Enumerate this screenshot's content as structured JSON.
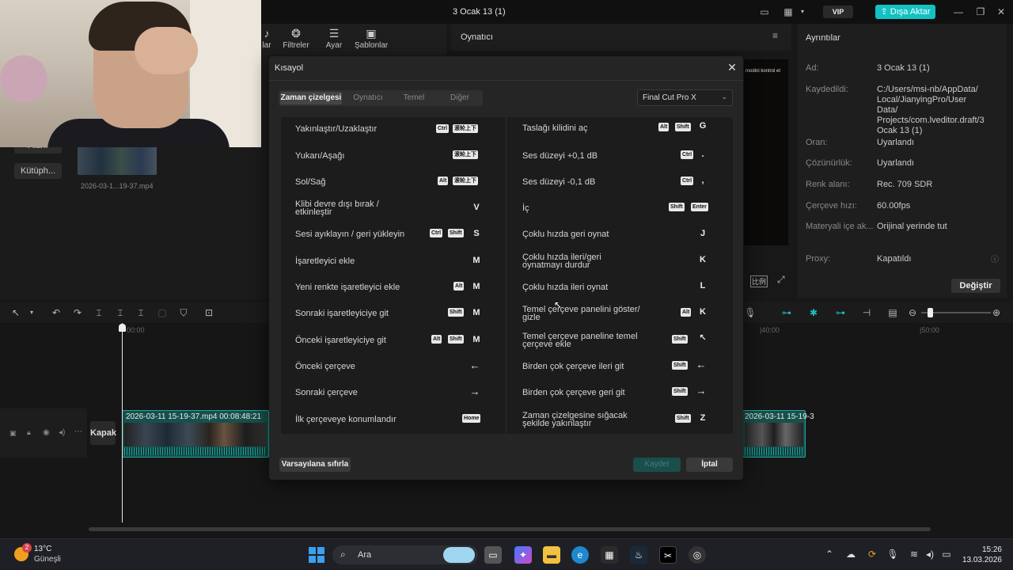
{
  "window": {
    "title": "3 Ocak 13 (1)"
  },
  "titlebar": {
    "vip_label": "VIP",
    "export_label": "Dışa Aktar",
    "export_icon": "share-icon",
    "minimize_icon": "minimize-icon",
    "maximize_icon": "restore-icon",
    "close_icon": "close-icon"
  },
  "toolbar": {
    "items": [
      {
        "label": "lar",
        "icon": "audio-icon"
      },
      {
        "label": "Filtreler",
        "icon": "filter-icon"
      },
      {
        "label": "Ayar",
        "icon": "sliders-icon"
      },
      {
        "label": "Şablonlar",
        "icon": "template-icon"
      }
    ]
  },
  "media": {
    "side_items": [
      {
        "label": "Alanı"
      },
      {
        "label": "Kütüph..."
      }
    ],
    "thumb_label": "2026-03-1...19-37.mp4"
  },
  "player": {
    "title": "Oynatıcı",
    "overlay_text": "modini kontrol et"
  },
  "details": {
    "title": "Ayrıntılar",
    "rows": [
      {
        "label": "Ad:",
        "value": "3 Ocak 13 (1)"
      },
      {
        "label": "Kaydedildi:",
        "value": "C:/Users/msi-nb/AppData/ Local/JianyingPro/User Data/ Projects/com.lveditor.draft/3 Ocak 13 (1)"
      },
      {
        "label": "Oran:",
        "value": "Uyarlandı"
      },
      {
        "label": "Çözünürlük:",
        "value": "Uyarlandı"
      },
      {
        "label": "Renk alanı:",
        "value": "Rec. 709 SDR"
      },
      {
        "label": "Çerçeve hızı:",
        "value": "60.00fps"
      },
      {
        "label": "Materyali içe ak...",
        "value": "Orijinal yerinde tut"
      },
      {
        "label": "Proxy:",
        "value": "Kapatıldı"
      }
    ],
    "change_label": "Değiştir"
  },
  "timeline": {
    "ruler": [
      "00:00",
      "|40:00",
      "|50:00"
    ],
    "cover_label": "Kapak",
    "clip1_label": "2026-03-11 15-19-37.mp4  00:08:48:21",
    "clip2_label": "2026-03-11 15-19-3"
  },
  "dialog": {
    "title": "Kısayol",
    "tabs": [
      "Zaman çizelgesi",
      "Oynatıcı",
      "Temel",
      "Diğer"
    ],
    "active_tab": "Zaman çizelgesi",
    "preset": "Final Cut Pro X",
    "left_rows": [
      {
        "label": "Yakınlaştır/Uzaklaştır",
        "mods": [
          "Ctrl",
          "滚轮上下"
        ],
        "key": ""
      },
      {
        "label": "Yukarı/Aşağı",
        "mods": [
          "滚轮上下"
        ],
        "key": ""
      },
      {
        "label": "Sol/Sağ",
        "mods": [
          "Alt",
          "滚轮上下"
        ],
        "key": ""
      },
      {
        "label": "Klibi devre dışı bırak / etkinleştir",
        "mods": [],
        "key": "V"
      },
      {
        "label": "Sesi ayıklayın / geri yükleyin",
        "mods": [
          "Ctrl",
          "Shift"
        ],
        "key": "S"
      },
      {
        "label": "İşaretleyici ekle",
        "mods": [],
        "key": "M"
      },
      {
        "label": "Yeni renkte işaretleyici ekle",
        "mods": [
          "Alt"
        ],
        "key": "M"
      },
      {
        "label": "Sonraki işaretleyiciye git",
        "mods": [
          "Shift"
        ],
        "key": "M"
      },
      {
        "label": "Önceki işaretleyiciye git",
        "mods": [
          "Alt",
          "Shift"
        ],
        "key": "M"
      },
      {
        "label": "Önceki çerçeve",
        "mods": [],
        "key": "←"
      },
      {
        "label": "Sonraki çerçeve",
        "mods": [],
        "key": "→"
      },
      {
        "label": "İlk çerçeveye konumlandır",
        "mods": [
          "Home"
        ],
        "key": ""
      }
    ],
    "right_rows": [
      {
        "label": "Taslağı kilidini aç",
        "mods": [
          "Alt",
          "Shift"
        ],
        "key": "G"
      },
      {
        "label": "Ses düzeyi +0,1 dB",
        "mods": [
          "Ctrl"
        ],
        "key": "."
      },
      {
        "label": "Ses düzeyi -0,1 dB",
        "mods": [
          "Ctrl"
        ],
        "key": ","
      },
      {
        "label": "İç",
        "mods": [
          "Shift",
          "Enter"
        ],
        "key": ""
      },
      {
        "label": "Çoklu hızda geri oynat",
        "mods": [],
        "key": "J"
      },
      {
        "label": "Çoklu hızda ileri/geri oynatmayı durdur",
        "mods": [],
        "key": "K"
      },
      {
        "label": "Çoklu hızda ileri oynat",
        "mods": [],
        "key": "L"
      },
      {
        "label": "Temel çerçeve panelini göster/ gizle",
        "mods": [
          "Alt"
        ],
        "key": "K"
      },
      {
        "label": "Temel çerçeve paneline temel çerçeve ekle",
        "mods": [
          "Shift"
        ],
        "key": ""
      },
      {
        "label": "Birden çok çerçeve ileri git",
        "mods": [
          "Shift"
        ],
        "key": "←"
      },
      {
        "label": "Birden çok çerçeve geri git",
        "mods": [
          "Shift"
        ],
        "key": "→"
      },
      {
        "label": "Zaman çizelgesine sığacak şekilde yakınlaştır",
        "mods": [
          "Shift"
        ],
        "key": "Z"
      }
    ],
    "reset_label": "Varsayılana sıfırla",
    "save_label": "Kaydet",
    "cancel_label": "İptal"
  },
  "taskbar": {
    "weather_badge": "2",
    "temperature": "13°C",
    "condition": "Güneşli",
    "search_placeholder": "Ara",
    "time": "15:26",
    "date": "13.03.2026"
  },
  "colors": {
    "accent": "#12c2c2",
    "clip": "#16504c",
    "dialog_bg": "#252525"
  }
}
